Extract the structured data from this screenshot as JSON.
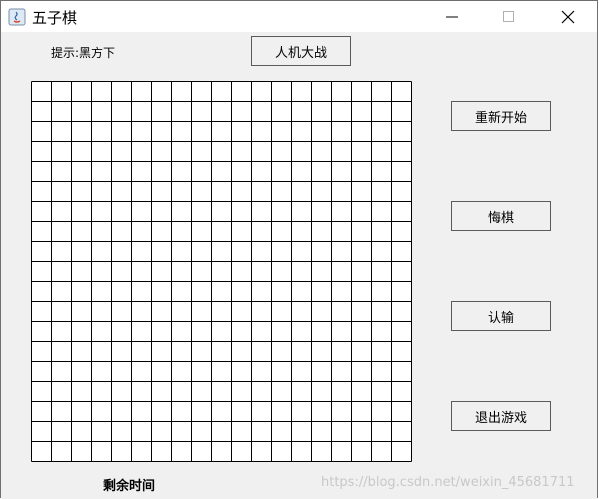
{
  "window": {
    "title": "五子棋",
    "controls": [
      "minimize",
      "maximize",
      "close"
    ]
  },
  "status": {
    "hint": "提示:黑方下"
  },
  "buttons": {
    "ai_battle": "人机大战",
    "restart": "重新开始",
    "undo": "悔棋",
    "surrender": "认输",
    "exit": "退出游戏"
  },
  "board": {
    "cells": 19,
    "line_color": "#000000",
    "background": "#ffffff"
  },
  "footer": {
    "timer_label": "剩余时间",
    "watermark": "https://blog.csdn.net/weixin_45681711"
  },
  "colors": {
    "window_bg": "#f0f0f0",
    "titlebar_bg": "#ffffff"
  }
}
